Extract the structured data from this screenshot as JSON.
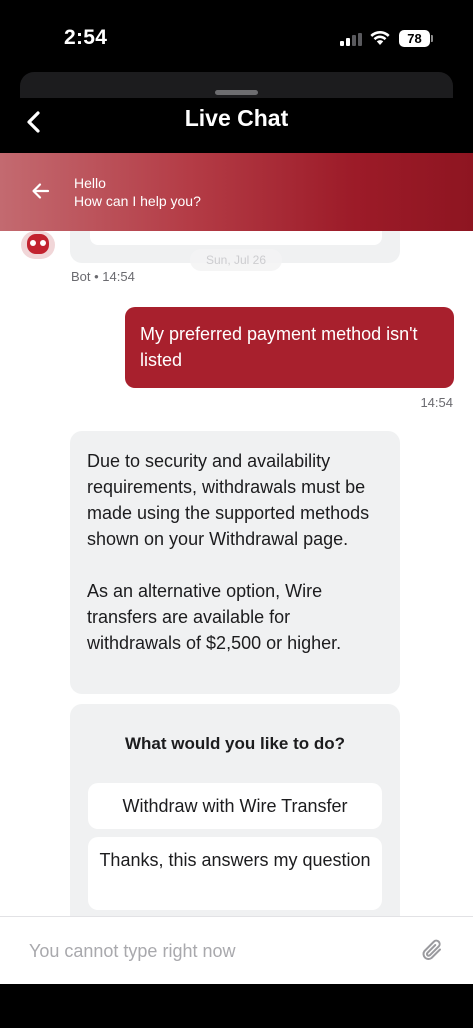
{
  "status_bar": {
    "time": "2:54",
    "battery": "78"
  },
  "header": {
    "title": "Live Chat"
  },
  "banner": {
    "greeting": "Hello",
    "prompt": "How can I help you?"
  },
  "chat": {
    "date_chip": "Sun, Jul 26",
    "bot_meta": "Bot • 14:54",
    "user_message": "My preferred payment method isn't listed",
    "user_time": "14:54",
    "bot_message_p1": "Due to security and availability requirements, withdrawals must be made using the supported methods shown on your Withdrawal page.",
    "bot_message_p2": "As an alternative option, Wire transfers are available for withdrawals of $2,500 or higher.",
    "options": {
      "title": "What would you like to do?",
      "items": [
        "Withdraw with Wire Transfer",
        "Thanks, this answers my question"
      ]
    }
  },
  "input": {
    "placeholder": "You cannot type right now"
  },
  "colors": {
    "user_bubble": "#a8202d",
    "bot_bubble": "#f0f1f2",
    "banner_end": "#8e1521"
  }
}
